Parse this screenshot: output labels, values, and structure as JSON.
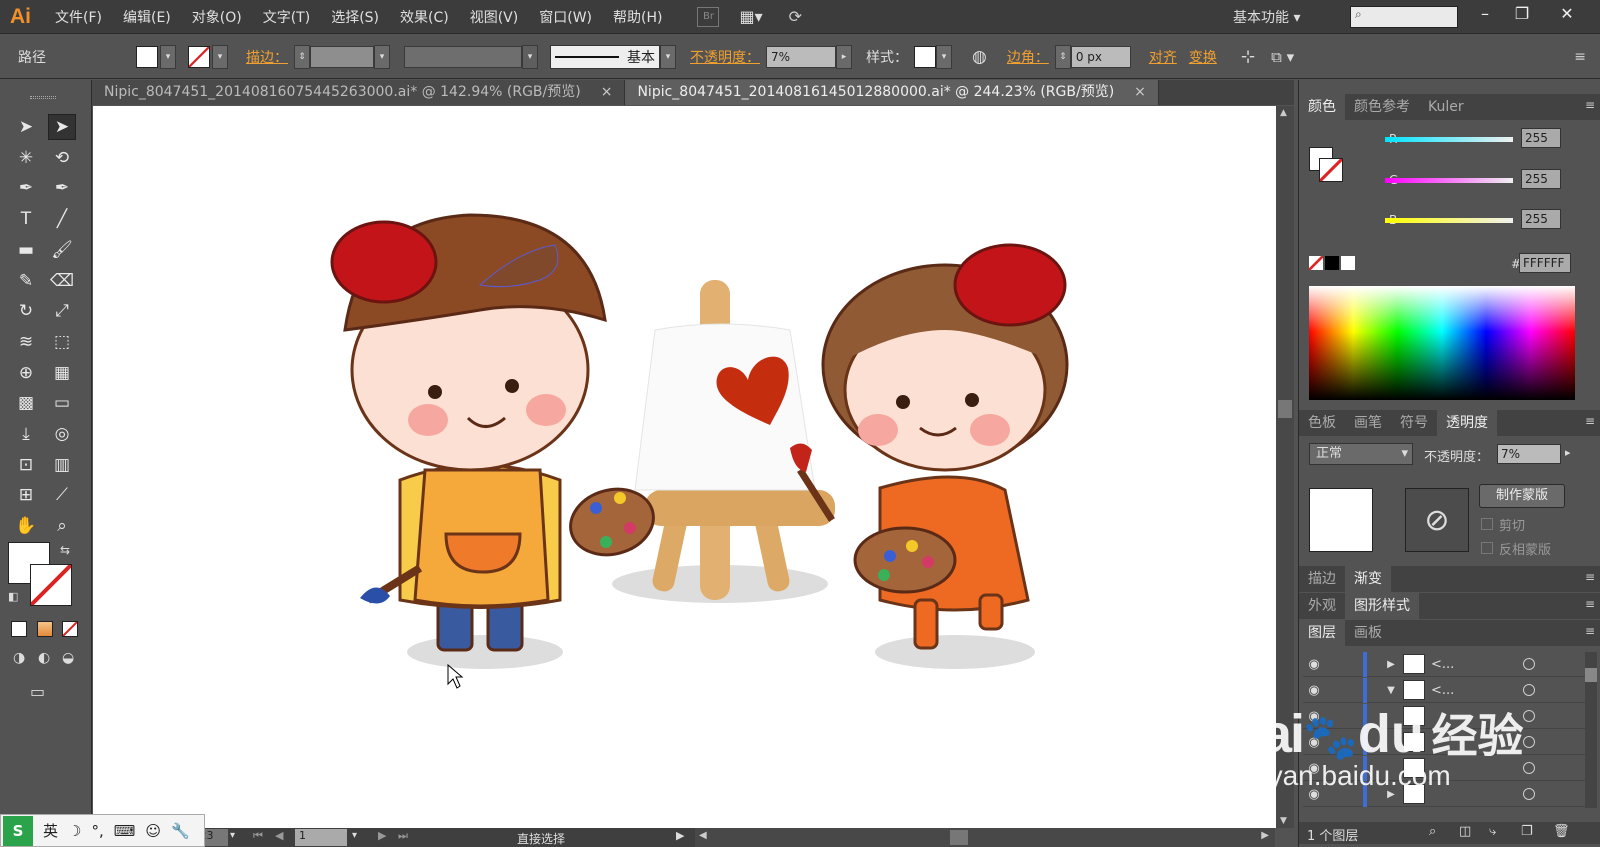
{
  "app": {
    "logo": "Ai"
  },
  "menu": [
    "文件(F)",
    "编辑(E)",
    "对象(O)",
    "文字(T)",
    "选择(S)",
    "效果(C)",
    "视图(V)",
    "窗口(W)",
    "帮助(H)"
  ],
  "menubar_icons": {
    "bridge": "Br",
    "arrange": "arrange-icon",
    "sync": "sync-icon"
  },
  "workspace": "基本功能",
  "window_controls": {
    "minimize": "minimize-icon",
    "restore": "restore-icon",
    "close": "close-icon"
  },
  "control_bar": {
    "selection_label": "路径",
    "stroke_label": "描边：",
    "stroke_style": "基本",
    "opacity_label": "不透明度：",
    "opacity_value": "7%",
    "style_label": "样式：",
    "corner_label": "边角：",
    "corner_value": "0 px",
    "align_label": "对齐",
    "transform_label": "变换"
  },
  "tabs": [
    {
      "title": "Nipic_8047451_20140816075445263000.ai* @ 142.94% (RGB/预览)",
      "active": false,
      "close": "×"
    },
    {
      "title": "Nipic_8047451_20140816145012880000.ai* @ 244.23% (RGB/预览)",
      "active": true,
      "close": "×"
    }
  ],
  "tools": [
    {
      "name": "selection-tool",
      "glyph": "➤"
    },
    {
      "name": "direct-selection-tool",
      "glyph": "➤"
    },
    {
      "name": "magic-wand-tool",
      "glyph": "✳"
    },
    {
      "name": "lasso-tool",
      "glyph": "⟲"
    },
    {
      "name": "pen-tool",
      "glyph": "✒"
    },
    {
      "name": "curvature-tool",
      "glyph": "✒"
    },
    {
      "name": "type-tool",
      "glyph": "T"
    },
    {
      "name": "line-tool",
      "glyph": "╱"
    },
    {
      "name": "rectangle-tool",
      "glyph": "▬"
    },
    {
      "name": "paintbrush-tool",
      "glyph": "🖌"
    },
    {
      "name": "pencil-tool",
      "glyph": "✎"
    },
    {
      "name": "eraser-tool",
      "glyph": "⌫"
    },
    {
      "name": "rotate-tool",
      "glyph": "↻"
    },
    {
      "name": "scale-tool",
      "glyph": "⤢"
    },
    {
      "name": "warp-tool",
      "glyph": "≋"
    },
    {
      "name": "free-transform-tool",
      "glyph": "⬚"
    },
    {
      "name": "shape-builder-tool",
      "glyph": "⊕"
    },
    {
      "name": "perspective-grid-tool",
      "glyph": "▦"
    },
    {
      "name": "mesh-tool",
      "glyph": "▩"
    },
    {
      "name": "gradient-tool",
      "glyph": "▭"
    },
    {
      "name": "eyedropper-tool",
      "glyph": "⤓"
    },
    {
      "name": "blend-tool",
      "glyph": "◎"
    },
    {
      "name": "symbol-sprayer-tool",
      "glyph": "⊡"
    },
    {
      "name": "column-graph-tool",
      "glyph": "▥"
    },
    {
      "name": "artboard-tool",
      "glyph": "⊞"
    },
    {
      "name": "slice-tool",
      "glyph": "⟋"
    },
    {
      "name": "hand-tool",
      "glyph": "✋"
    },
    {
      "name": "zoom-tool",
      "glyph": "⌕"
    }
  ],
  "status": {
    "zoom": "244.23",
    "artboard": "1",
    "tool_name": "直接选择"
  },
  "color_panel": {
    "tabs": [
      "颜色",
      "颜色参考",
      "Kuler"
    ],
    "channels": [
      {
        "label": "R",
        "value": "255",
        "color": "#00e5ff"
      },
      {
        "label": "G",
        "value": "255",
        "color": "#ff00ff"
      },
      {
        "label": "B",
        "value": "255",
        "color": "#ffff00"
      }
    ],
    "hash": "#",
    "hex": "FFFFFF"
  },
  "transparency_panel": {
    "tabs": [
      "色板",
      "画笔",
      "符号",
      "透明度"
    ],
    "blend_mode": "正常",
    "opacity_label": "不透明度：",
    "opacity_value": "7%",
    "make_mask": "制作蒙版",
    "clip": "剪切",
    "invert_mask": "反相蒙版"
  },
  "stroke_gradient_tabs": [
    "描边",
    "渐变"
  ],
  "appearance_tabs": [
    "外观",
    "图形样式"
  ],
  "layers_panel": {
    "tabs": [
      "图层",
      "画板"
    ],
    "rows": [
      {
        "name": "<...",
        "arrow": "▶"
      },
      {
        "name": "<...",
        "arrow": "▼"
      },
      {
        "name": "",
        "arrow": ""
      },
      {
        "name": "",
        "arrow": ""
      },
      {
        "name": "",
        "arrow": ""
      },
      {
        "name": "",
        "arrow": "▶"
      }
    ],
    "footer": "1 个图层"
  },
  "ime": {
    "lang": "英"
  },
  "watermark": {
    "brand": "Bai",
    "brand2": "du",
    "sub": "经验",
    "url": "jingyan.baidu.com"
  }
}
